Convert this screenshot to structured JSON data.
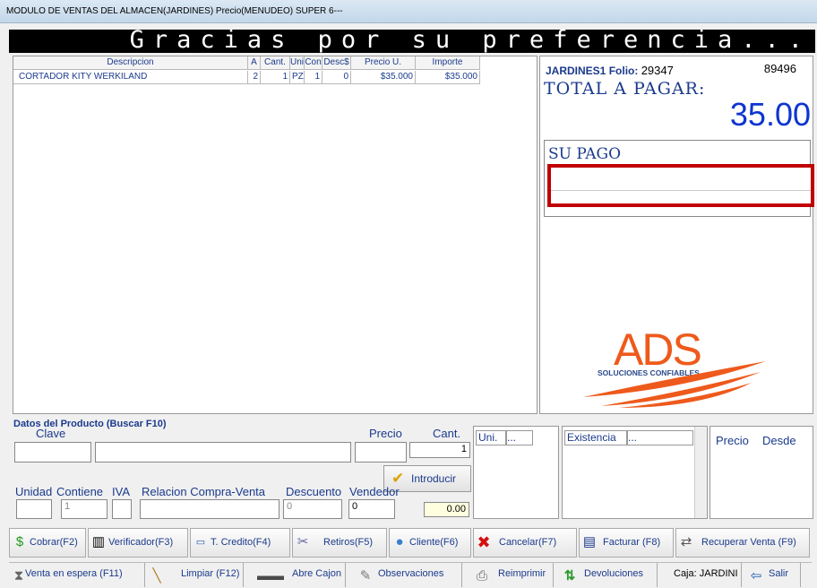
{
  "title": "MODULO DE VENTAS DEL ALMACEN(JARDINES)  Precio(MENUDEO)  SUPER 6---",
  "banner": "Gracias por su preferencia...",
  "grid": {
    "headers": [
      "Descripcion",
      "A",
      "Cant.",
      "Uni",
      "Con",
      "Desc$",
      "Precio U.",
      "Importe"
    ],
    "row": {
      "descripcion": "CORTADOR KITY WERKILAND",
      "a": "2",
      "cant": "1",
      "uni": "PZA",
      "con": "1",
      "desc": "0",
      "precio": "$35.000",
      "importe": "$35.000"
    }
  },
  "summary": {
    "store": "JARDINES1",
    "folio_label": "Folio:",
    "folio": "29347",
    "num": "89496",
    "total_label": "TOTAL A PAGAR:",
    "total": "35.00",
    "pago_label": "SU PAGO"
  },
  "logo": {
    "brand": "ADS",
    "tagline": "SOLUCIONES CONFIABLES",
    "accent": "#ee5a1c"
  },
  "product": {
    "section": "Datos del Producto (Buscar F10)",
    "clave": "Clave",
    "precio": "Precio",
    "cant": "Cant.",
    "cant_value": "1",
    "unidad": "Unidad",
    "contiene": "Contiene",
    "iva": "IVA",
    "relacion": "Relacion Compra-Venta",
    "descuento": "Descuento",
    "vendedor": "Vendedor",
    "contiene_value": "1",
    "descuento_value": "0",
    "vendedor_value": "0",
    "total_value": "0.00",
    "introducir": "Introducir"
  },
  "panels": {
    "uni": "Uni.",
    "uni_more": "...",
    "existencia": "Existencia",
    "existencia_more": "...",
    "precio": "Precio",
    "desde": "Desde"
  },
  "toolbar": [
    "Cobrar(F2)",
    "Verificador(F3)",
    "T. Credito(F4)",
    "Retiros(F5)",
    "Cliente(F6)",
    "Cancelar(F7)",
    "Facturar (F8)",
    "Recuperar Venta (F9)"
  ],
  "statusbar": [
    "Venta en espera  (F11)",
    "Limpiar (F12)",
    "Abre Cajon",
    "Observaciones",
    "Reimprimir",
    "Devoluciones",
    "Caja: JARDINI",
    "Salir"
  ]
}
